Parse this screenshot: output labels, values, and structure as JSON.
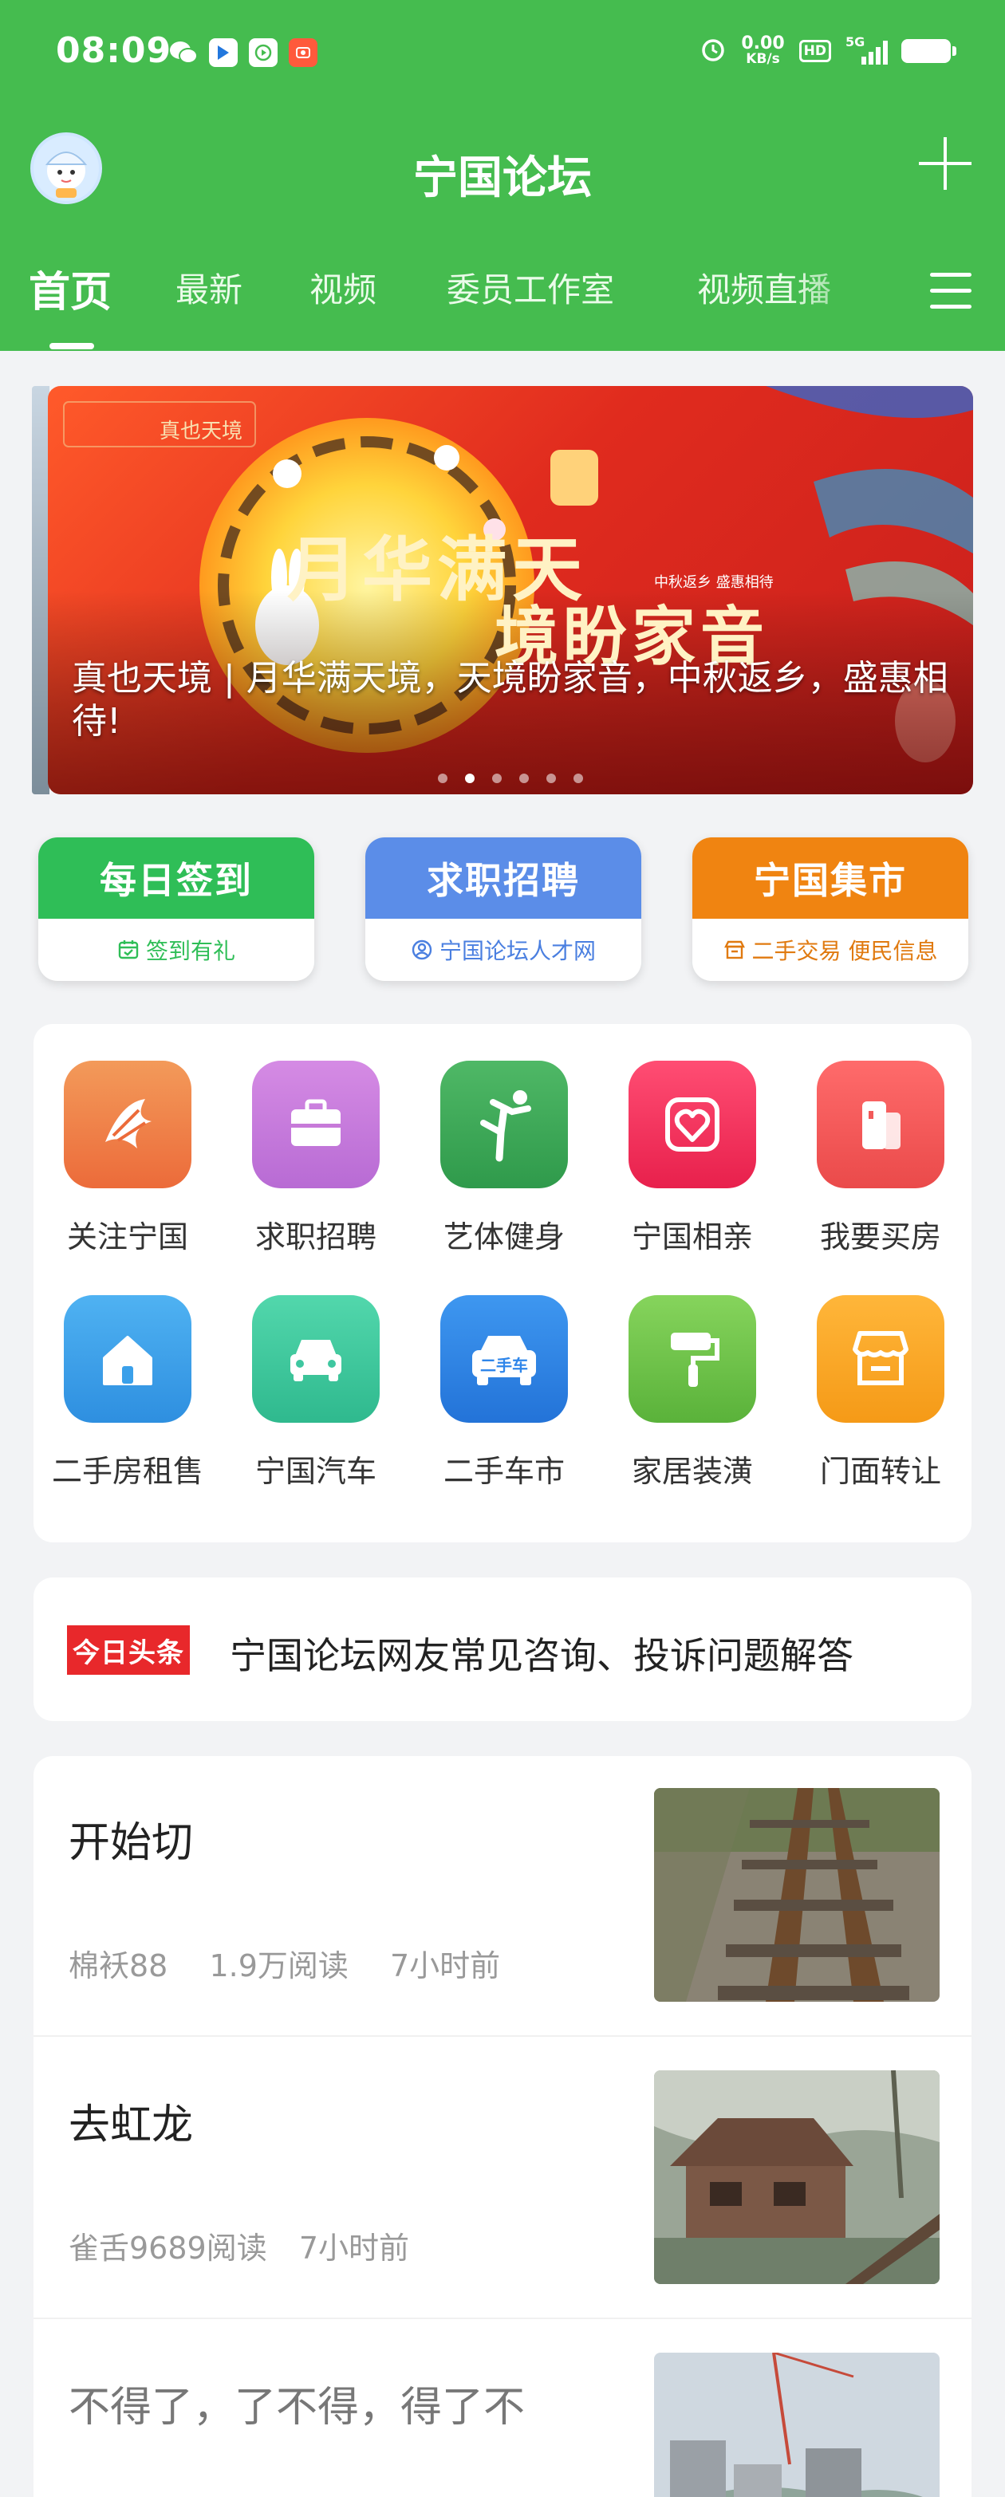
{
  "status_bar": {
    "time": "08:09",
    "net_speed_value": "0.00",
    "net_speed_unit": "KB/s",
    "hd": "HD",
    "signal": "5G"
  },
  "app": {
    "title": "宁国论坛"
  },
  "tabs": [
    {
      "label": "首页",
      "active": true
    },
    {
      "label": "最新"
    },
    {
      "label": "视频"
    },
    {
      "label": "委员工作室"
    },
    {
      "label": "视频直播"
    }
  ],
  "banner": {
    "caption": "真也天境 | 月华满天境，天境盼家音，中秋返乡，盛惠相待!",
    "art_text_1": "月华满天",
    "art_text_2": "境盼家音",
    "art_small": "中秋返乡  盛惠相待",
    "brand": "真也天境",
    "dot_count": 6,
    "active_dot": 1
  },
  "quick_cards": [
    {
      "title": "每日签到",
      "subtitle": "签到有礼",
      "color": "#2fbe57",
      "sub_color": "#2fbe57"
    },
    {
      "title": "求职招聘",
      "subtitle": "宁国论坛人才网",
      "color": "#5b8de8",
      "sub_color": "#4a7fe0"
    },
    {
      "title": "宁国集市",
      "subtitle": "二手交易 便民信息",
      "color": "#f08411",
      "sub_color": "#e07a10"
    }
  ],
  "grid": [
    {
      "label": "关注宁国",
      "icon": "fan-logo-icon",
      "color": "#f07a3c"
    },
    {
      "label": "求职招聘",
      "icon": "briefcase-icon",
      "color": "#c77ad9"
    },
    {
      "label": "艺体健身",
      "icon": "dancer-icon",
      "color": "#3fa85a"
    },
    {
      "label": "宁国相亲",
      "icon": "heart-icon",
      "color": "#f0345e"
    },
    {
      "label": "我要买房",
      "icon": "building-icon",
      "color": "#f25a5a"
    },
    {
      "label": "二手房租售",
      "icon": "house-icon",
      "color": "#3aa0ea"
    },
    {
      "label": "宁国汽车",
      "icon": "car-icon",
      "color": "#3ec7a0"
    },
    {
      "label": "二手车市",
      "icon": "used-car-icon",
      "color": "#2f86ea",
      "icon_text": "二手车"
    },
    {
      "label": "家居装潢",
      "icon": "paint-roller-icon",
      "color": "#6fc24a"
    },
    {
      "label": "门面转让",
      "icon": "store-icon",
      "color": "#f5a623"
    }
  ],
  "headline": {
    "logo_text": "今日头条",
    "text": "宁国论坛网友常见咨询、投诉问题解答"
  },
  "feed": [
    {
      "title": "开始切",
      "author": "棉袄88",
      "reads": "1.9万阅读",
      "time": "7小时前",
      "image": "railway-photo"
    },
    {
      "title": "去虹龙",
      "author": "雀舌9689阅读",
      "reads": "",
      "time": "7小时前",
      "image": "cabin-photo"
    },
    {
      "title": "不得了，了不得，得了不",
      "author": "",
      "reads": "",
      "time": "",
      "image": "buildings-photo"
    }
  ]
}
